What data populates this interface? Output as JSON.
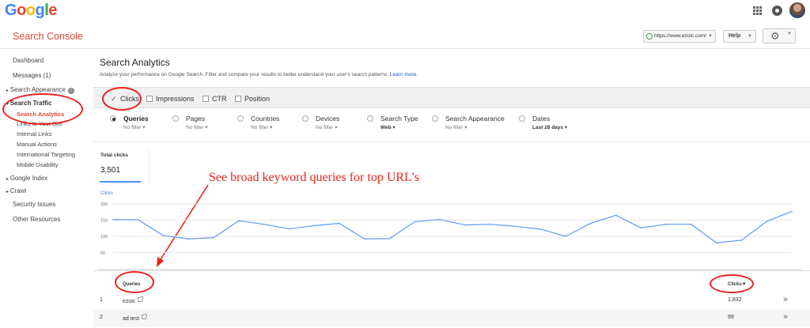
{
  "topbar": {
    "logo": {
      "G": "G",
      "o1": "o",
      "o2": "o",
      "g": "g",
      "l": "l",
      "e": "e"
    },
    "icons": [
      "apps-grid-icon",
      "notifications-icon",
      "account-avatar"
    ]
  },
  "header": {
    "app_title": "Search Console",
    "site": "https://www.ezoic.com/",
    "help_label": "Help",
    "settings_icon": "gear-icon"
  },
  "sidebar": {
    "dashboard": "Dashboard",
    "messages": "Messages (1)",
    "search_appearance": "Search Appearance",
    "search_traffic": "Search Traffic",
    "search_analytics": "Search Analytics",
    "links_to_site": "Links to Your Site",
    "internal_links": "Internal Links",
    "manual_actions": "Manual Actions",
    "international_targeting": "International Targeting",
    "mobile_usability": "Mobile Usability",
    "google_index": "Google Index",
    "crawl": "Crawl",
    "security_issues": "Security Issues",
    "other_resources": "Other Resources"
  },
  "main": {
    "title": "Search Analytics",
    "description": "Analyze your performance on Google Search. Filter and compare your results to better understand your user's search patterns.",
    "learn_more": "Learn more.",
    "metrics": {
      "clicks": {
        "label": "Clicks",
        "checked": true
      },
      "impressions": {
        "label": "Impressions",
        "checked": false
      },
      "ctr": {
        "label": "CTR",
        "checked": false
      },
      "position": {
        "label": "Position",
        "checked": false
      }
    },
    "groupings": [
      {
        "label": "Queries",
        "filter": "No filter",
        "selected": true
      },
      {
        "label": "Pages",
        "filter": "No filter",
        "selected": false
      },
      {
        "label": "Countries",
        "filter": "No filter",
        "selected": false
      },
      {
        "label": "Devices",
        "filter": "No filter",
        "selected": false
      },
      {
        "label": "Search Type",
        "filter": "Web",
        "selected": false
      },
      {
        "label": "Search Appearance",
        "filter": "No filter",
        "selected": false
      },
      {
        "label": "Dates",
        "filter": "Last 28 days",
        "selected": false
      }
    ],
    "total_clicks_label": "Total clicks",
    "total_clicks_value": "3,501",
    "annotation": "See broad keyword queries for top URL's"
  },
  "chart_data": {
    "type": "line",
    "title": "",
    "ylabel": "Clicks",
    "ylim": [
      0,
      200
    ],
    "yticks": [
      "200",
      "150",
      "100",
      "50"
    ],
    "grid": true,
    "color": "#5b9bf0",
    "series": [
      {
        "values": [
          152,
          151,
          102,
          92,
          96,
          148,
          137,
          123,
          133,
          140,
          92,
          93,
          145,
          152,
          135,
          137,
          131,
          122,
          100,
          140,
          165,
          126,
          137,
          137,
          80,
          88,
          146,
          177
        ]
      }
    ]
  },
  "table": {
    "col_queries": "Queries",
    "col_clicks": "Clicks▼",
    "rows": [
      {
        "idx": "1",
        "query": "ezoic",
        "clicks": "1,832",
        "more": "»"
      },
      {
        "idx": "2",
        "query": "ad test",
        "clicks": "99",
        "more": "»"
      }
    ]
  }
}
